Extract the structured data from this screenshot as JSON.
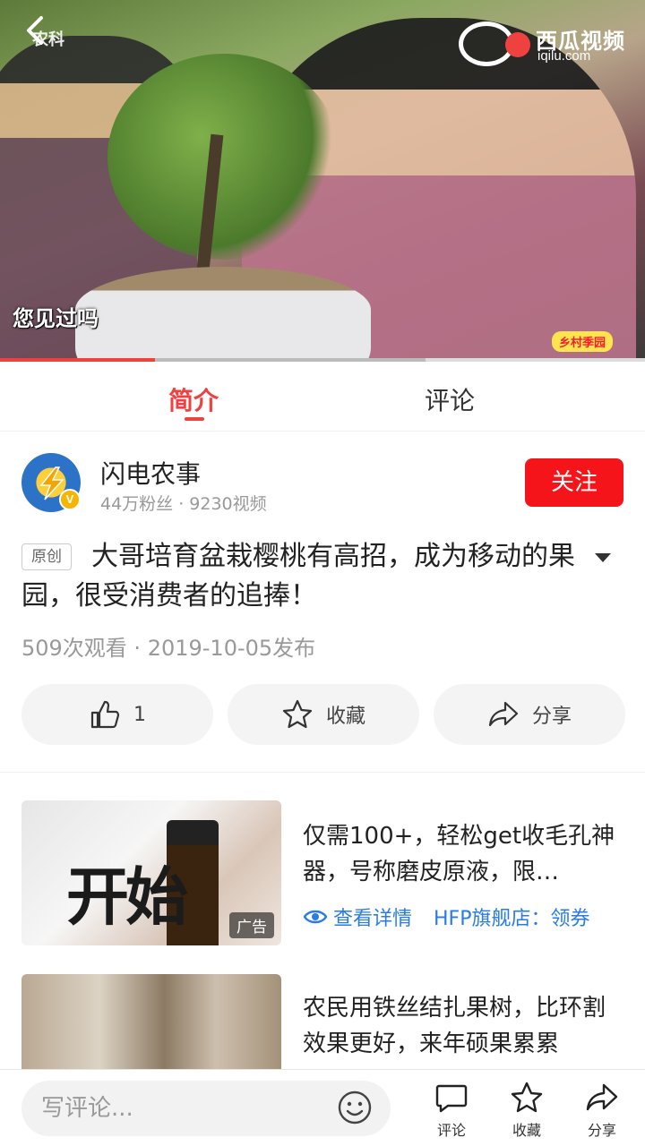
{
  "video": {
    "subtitle": "您见过吗",
    "channel_logo_text": "农科",
    "watermark_name": "西瓜视频",
    "watermark_url": "iqilu.com",
    "corner_badge": "乡村季园",
    "progress_played": 0.24,
    "progress_buffered": 0.66
  },
  "tabs": [
    {
      "label": "简介",
      "active": true
    },
    {
      "label": "评论",
      "active": false
    }
  ],
  "author": {
    "name": "闪电农事",
    "stats": "44万粉丝 · 9230视频",
    "verified_badge": "V",
    "follow_label": "关注"
  },
  "detail": {
    "tag": "原创",
    "title": "大哥培育盆栽樱桃有高招，成为移动的果园，很受消费者的追捧！",
    "meta": "509次观看 · 2019-10-05发布"
  },
  "actions": {
    "like_count": "1",
    "favorite_label": "收藏",
    "share_label": "分享"
  },
  "feed": [
    {
      "title": "仅需100+，轻松get收毛孔神器，号称磨皮原液，限…",
      "thumb_text": "开始",
      "ad_label": "广告",
      "link_label": "查看详情",
      "source": "HFP旗舰店：领券"
    },
    {
      "title": "农民用铁丝结扎果树，比环割效果更好，来年硕果累累"
    }
  ],
  "bottom_bar": {
    "comment_placeholder": "写评论...",
    "comment_label": "评论",
    "favorite_label": "收藏",
    "share_label": "分享"
  },
  "colors": {
    "accent": "#f04141",
    "follow_button": "#f4141a",
    "link_blue": "#2a7be4"
  }
}
